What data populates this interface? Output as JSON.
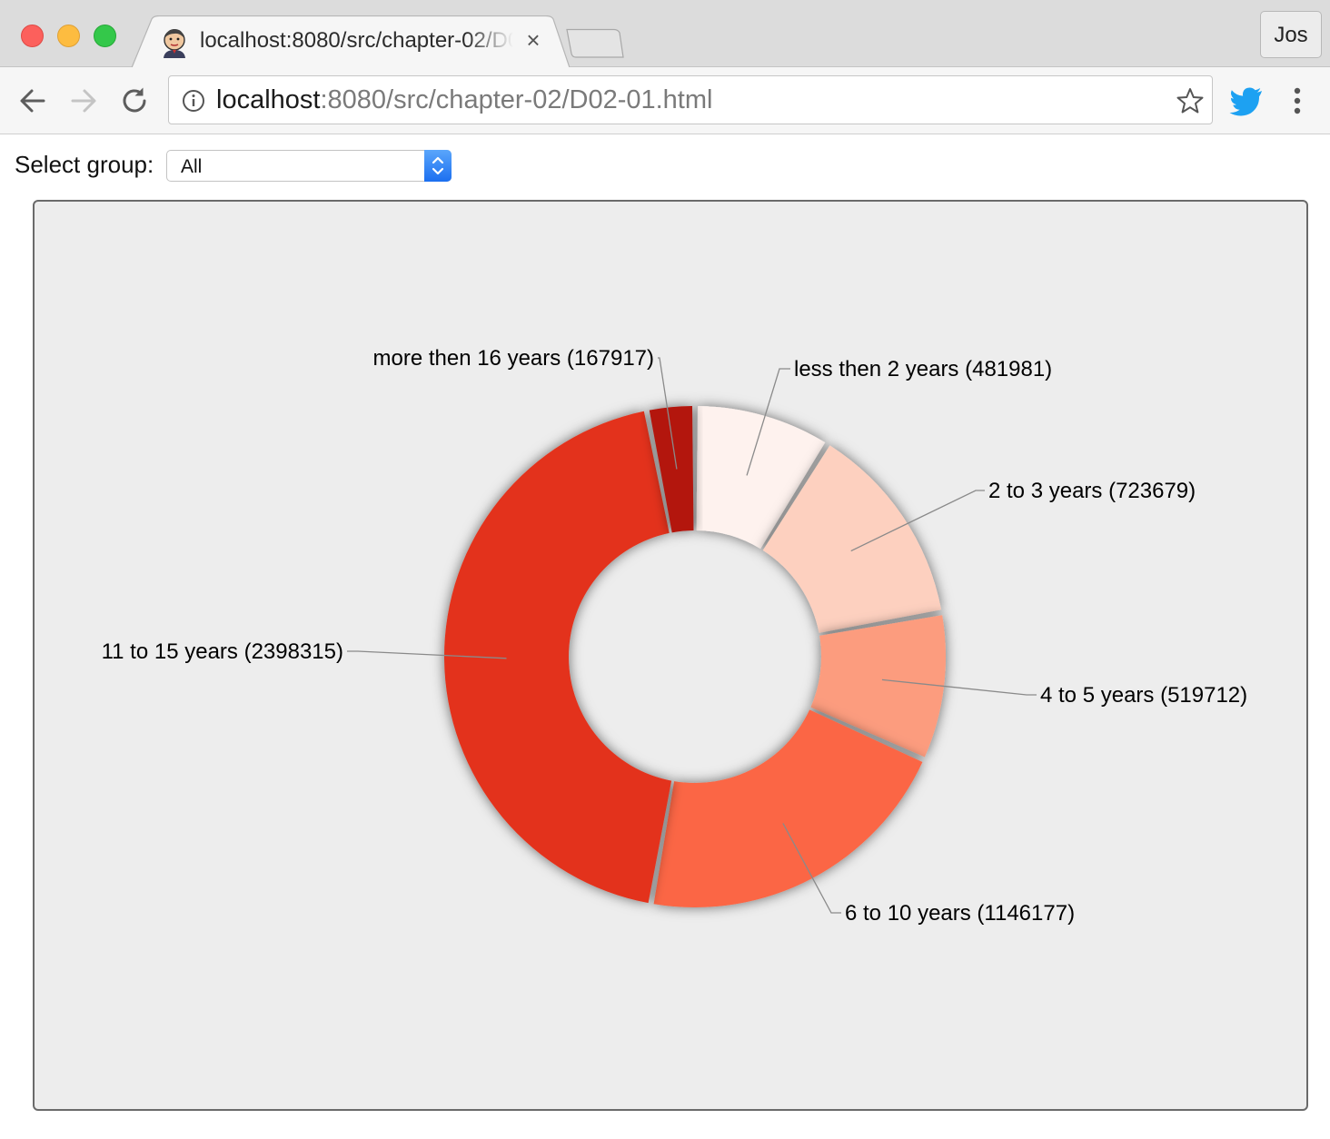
{
  "browser": {
    "tab_title": "localhost:8080/src/chapter-02/D02-01.html",
    "profile_label": "Jos",
    "url_host": "localhost",
    "url_rest": ":8080/src/chapter-02/D02-01.html"
  },
  "icons": {
    "favicon": "jenkins-butler-icon",
    "back": "arrow-left-icon",
    "forward": "arrow-right-icon",
    "reload": "reload-icon",
    "site_info": "info-icon",
    "bookmark": "star-icon",
    "extension": "twitter-bird-icon",
    "menu": "kebab-menu-icon"
  },
  "controls": {
    "select_label": "Select group:",
    "select_value": "All"
  },
  "chart_data": {
    "type": "pie",
    "donut": true,
    "colors": {
      "panel_background": "#ededed"
    },
    "slices": [
      {
        "label": "less then 2 years (481981)",
        "category": "less then 2 years",
        "value": 481981,
        "color": "#fef2ee"
      },
      {
        "label": "2 to 3 years (723679)",
        "category": "2 to 3 years",
        "value": 723679,
        "color": "#fdd0bf"
      },
      {
        "label": "4 to 5 years (519712)",
        "category": "4 to 5 years",
        "value": 519712,
        "color": "#fc9c7e"
      },
      {
        "label": "6 to 10 years (1146177)",
        "category": "6 to 10 years",
        "value": 1146177,
        "color": "#fb6644"
      },
      {
        "label": "11 to 15 years (2398315)",
        "category": "11 to 15 years",
        "value": 2398315,
        "color": "#e3321a"
      },
      {
        "label": "more then 16 years (167917)",
        "category": "more then 16 years",
        "value": 167917,
        "color": "#b3130d"
      }
    ]
  }
}
